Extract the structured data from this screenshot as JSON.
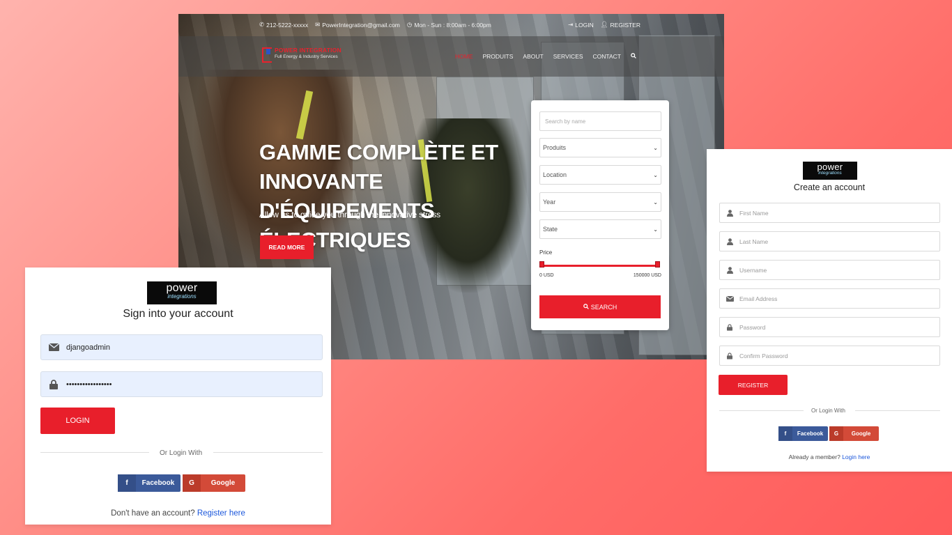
{
  "website": {
    "topbar": {
      "phone": "212-5222-xxxxx",
      "email": "PowerIntegration@gmail.com",
      "hours": "Mon - Sun : 8:00am - 6:00pm",
      "login": "LOGIN",
      "register": "REGISTER"
    },
    "brand": {
      "name": "POWER INTEGRATION",
      "tagline": "Full Energy & Industry Services"
    },
    "menu": [
      "HOME",
      "PRODUITS",
      "ABOUT",
      "SERVICES",
      "CONTACT"
    ],
    "hero": {
      "line1": "GAMME COMPLÈTE ET INNOVANTE",
      "line2": "D'ÉQUIPEMENTS ÉLECTRIQUES",
      "subtitle": "Allow us to guide you through the innovative stress",
      "button": "READ MORE"
    },
    "search": {
      "placeholder": "Search by name",
      "selects": [
        "Produits",
        "Location",
        "Year",
        "State"
      ],
      "price_label": "Price",
      "price_min": "0 USD",
      "price_max": "150000 USD",
      "price_range_fraction": [
        0,
        1
      ],
      "button": "SEARCH"
    }
  },
  "login_card": {
    "logo_line1": "power",
    "logo_line2": "integrations",
    "title": "Sign into your account",
    "username_value": "djangoadmin",
    "password_value": "•••••••••••••••••",
    "login_button": "LOGIN",
    "or_text": "Or Login With",
    "facebook": "Facebook",
    "google": "Google",
    "footer_text": "Don't have an account?",
    "footer_link": "Register here"
  },
  "register_card": {
    "logo_line1": "power",
    "logo_line2": "integrations",
    "title": "Create an account",
    "fields": [
      {
        "placeholder": "First Name",
        "icon": "user-icon"
      },
      {
        "placeholder": "Last Name",
        "icon": "user-icon"
      },
      {
        "placeholder": "Username",
        "icon": "user-icon"
      },
      {
        "placeholder": "Email Address",
        "icon": "envelope-icon"
      },
      {
        "placeholder": "Password",
        "icon": "lock-icon"
      },
      {
        "placeholder": "Confirm Password",
        "icon": "lock-icon"
      }
    ],
    "register_button": "REGISTER",
    "or_text": "Or Login With",
    "facebook": "Facebook",
    "google": "Google",
    "footer_text": "Already a member?",
    "footer_link": "Login here"
  },
  "colors": {
    "accent_red": "#e81f2b",
    "facebook_blue": "#3b5a9a",
    "google_red": "#d34a38",
    "link_blue": "#1a56db",
    "background_gradient": [
      "#ffb3ad",
      "#ff5b5b"
    ]
  }
}
